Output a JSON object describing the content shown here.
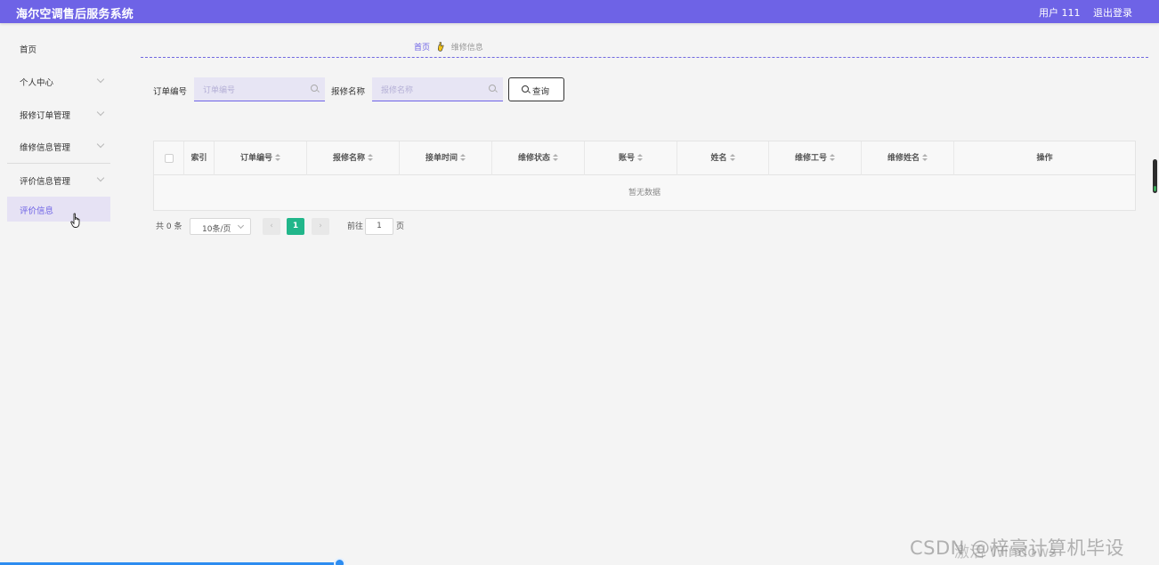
{
  "header": {
    "title": "海尔空调售后服务系统",
    "user": "用户 111",
    "logout": "退出登录",
    "bg_color": "#6e63e6"
  },
  "sidebar": {
    "items": [
      {
        "label": "首页",
        "has_chevron": false
      },
      {
        "label": "个人中心",
        "has_chevron": true
      },
      {
        "label": "报修订单管理",
        "has_chevron": true
      },
      {
        "label": "维修信息管理",
        "has_chevron": true
      },
      {
        "label": "评价信息管理",
        "has_chevron": true
      }
    ],
    "active_sub": "评价信息"
  },
  "breadcrumb": {
    "home": "首页",
    "current": "维修信息"
  },
  "search": {
    "field1_label": "订单编号",
    "field1_placeholder": "订单编号",
    "field2_label": "报修名称",
    "field2_placeholder": "报修名称",
    "query_button": "查询"
  },
  "table": {
    "columns": [
      "索引",
      "订单编号",
      "报修名称",
      "接单时间",
      "维修状态",
      "账号",
      "姓名",
      "维修工号",
      "维修姓名",
      "操作"
    ],
    "empty_text": "暂无数据"
  },
  "pagination": {
    "total": "共 0 条",
    "page_size": "10条/页",
    "prev": "‹",
    "current_page": "1",
    "next": "›",
    "goto_label": "前往",
    "goto_value": "1",
    "goto_suffix": "页"
  },
  "overlay": {
    "watermark": "CSDN @梓豪计算机毕设",
    "activation": "激活 Windows"
  },
  "colors": {
    "accent": "#6e63e6",
    "page_active": "#21b68a"
  }
}
